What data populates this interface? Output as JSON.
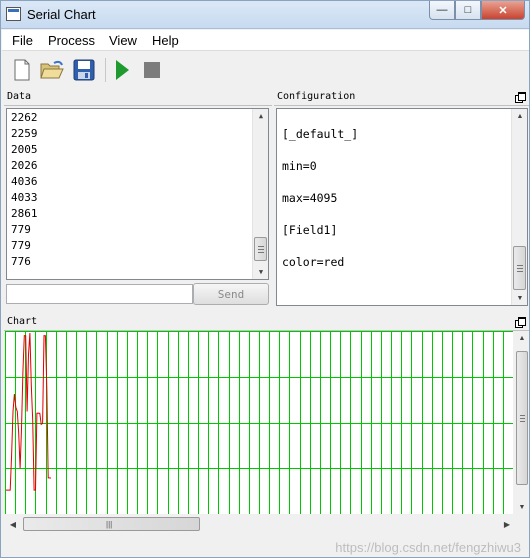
{
  "window": {
    "title": "Serial Chart",
    "minimize_glyph": "—",
    "maximize_glyph": "□",
    "close_glyph": "✕"
  },
  "menu": {
    "items": [
      "File",
      "Process",
      "View",
      "Help"
    ]
  },
  "toolbar": {
    "tools": [
      "new-file-icon",
      "open-folder-icon",
      "save-icon",
      "run-icon",
      "stop-icon"
    ],
    "run_color": "#1f9a2e",
    "stop_color": "#7c7c7c"
  },
  "data_panel": {
    "title": "Data",
    "lines": [
      "2262",
      "2259",
      "2005",
      "2026",
      "4036",
      "4033",
      "2861",
      "779",
      "779",
      "776"
    ],
    "send_input_value": "",
    "send_label": "Send"
  },
  "config_panel": {
    "title": "Configuration",
    "lines": [
      "[_default_]",
      "min=0",
      "max=4095",
      "[Field1]",
      "color=red"
    ]
  },
  "chart_panel": {
    "title": "Chart",
    "grid_color": "#00c800",
    "line_color": "#e00000"
  },
  "chart_data": {
    "type": "line",
    "series": [
      {
        "values": [
          500,
          500,
          500,
          500,
          1300,
          2300,
          2700,
          2400,
          2300,
          1800,
          1000,
          1900,
          3200,
          4036,
          4033,
          2300,
          3600,
          4095,
          2900,
          2100,
          500,
          500,
          2261,
          2262,
          2259,
          2005,
          2026,
          4036,
          4033,
          2861,
          779,
          779,
          776
        ]
      }
    ],
    "ylim": [
      0,
      4095
    ],
    "grid": true
  },
  "watermark": "https://blog.csdn.net/fengzhiwu3"
}
